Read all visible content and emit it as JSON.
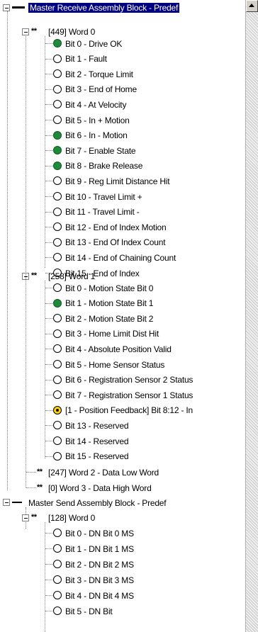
{
  "tree": {
    "receive_block": {
      "label": "Master Receive Assembly Block - Predef",
      "word0": {
        "label": "[449] Word 0",
        "bits": [
          {
            "label": "Bit 0 - Drive OK",
            "state": "on"
          },
          {
            "label": "Bit 1 - Fault",
            "state": "off"
          },
          {
            "label": "Bit 2 - Torque Limit",
            "state": "off"
          },
          {
            "label": "Bit 3 - End of Home",
            "state": "off"
          },
          {
            "label": "Bit 4 - At Velocity",
            "state": "off"
          },
          {
            "label": "Bit 5 - In + Motion",
            "state": "off"
          },
          {
            "label": "Bit 6 - In - Motion",
            "state": "on"
          },
          {
            "label": "Bit 7 - Enable State",
            "state": "on"
          },
          {
            "label": "Bit 8 - Brake Release",
            "state": "on"
          },
          {
            "label": "Bit 9 - Reg Limit Distance Hit",
            "state": "off"
          },
          {
            "label": "Bit 10 - Travel Limit +",
            "state": "off"
          },
          {
            "label": "Bit 11 - Travel Limit -",
            "state": "off"
          },
          {
            "label": "Bit 12 - End of Index Motion",
            "state": "off"
          },
          {
            "label": "Bit 13 - End Of Index Count",
            "state": "off"
          },
          {
            "label": "Bit 14 - End of Chaining Count",
            "state": "off"
          },
          {
            "label": "Bit 15 - End of Index",
            "state": "off"
          }
        ]
      },
      "word1": {
        "label": "[258] Word 1",
        "bits": [
          {
            "label": "Bit 0 - Motion State Bit 0",
            "state": "off"
          },
          {
            "label": "Bit 1 - Motion State Bit 1",
            "state": "on"
          },
          {
            "label": "Bit 2 - Motion State Bit 2",
            "state": "off"
          },
          {
            "label": "Bit 3 - Home Limit Dist Hit",
            "state": "off"
          },
          {
            "label": "Bit 4 - Absolute Position Valid",
            "state": "off"
          },
          {
            "label": "Bit 5 - Home Sensor Status",
            "state": "off"
          },
          {
            "label": "Bit 6 - Registration Sensor 2 Status",
            "state": "off"
          },
          {
            "label": "Bit 7 - Registration Sensor 1 Status",
            "state": "off"
          },
          {
            "label": "[1 - Position Feedback] Bit 8:12 - In",
            "state": "multi"
          },
          {
            "label": "Bit 13 - Reserved",
            "state": "off"
          },
          {
            "label": "Bit 14 - Reserved",
            "state": "off"
          },
          {
            "label": "Bit 15 - Reserved",
            "state": "off"
          }
        ]
      },
      "word2": {
        "label": "[247] Word 2 - Data Low Word"
      },
      "word3": {
        "label": "[0] Word 3 - Data High Word"
      }
    },
    "send_block": {
      "label": "Master Send Assembly Block - Predef",
      "word0": {
        "label": "[128] Word 0",
        "bits": [
          {
            "label": "Bit 0 - DN Bit  0 MS",
            "state": "off"
          },
          {
            "label": "Bit 1 - DN Bit  1 MS",
            "state": "off"
          },
          {
            "label": "Bit 2 - DN Bit  2 MS",
            "state": "off"
          },
          {
            "label": "Bit 3 - DN Bit  3 MS",
            "state": "off"
          },
          {
            "label": "Bit 4 - DN Bit  4 MS",
            "state": "off"
          },
          {
            "label": "Bit 5 - DN Bit",
            "state": "off"
          }
        ]
      }
    },
    "icons": {
      "block": "block-bar-icon",
      "word": "hash-icon",
      "bit_on": "green-filled-circle-icon",
      "bit_off": "empty-circle-icon",
      "multi": "yellow-multibit-icon"
    },
    "colors": {
      "selection_bg": "#000080",
      "selection_text": "#ffffff",
      "bit_on": "#1f8a3a"
    }
  }
}
